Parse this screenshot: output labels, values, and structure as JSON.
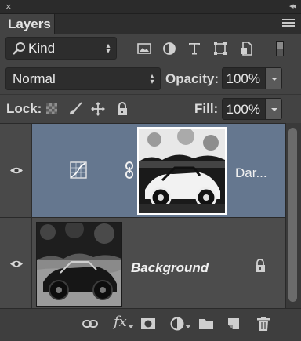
{
  "panel": {
    "close_glyph": "×",
    "collapse_glyph": "◂◂",
    "tab_label": "Layers",
    "menu_icon": "panel-menu-icon"
  },
  "filter": {
    "kind_label": "Kind",
    "icons": [
      "pixel-layer-filter-icon",
      "adjustment-layer-filter-icon",
      "type-layer-filter-icon",
      "shape-layer-filter-icon",
      "smart-object-filter-icon"
    ],
    "filter_toggle": "filter-toggle-icon"
  },
  "blend": {
    "mode": "Normal",
    "opacity_label": "Opacity:",
    "opacity_value": "100%"
  },
  "lock": {
    "label": "Lock:",
    "icons": [
      "lock-transparent-pixels-icon",
      "lock-image-pixels-icon",
      "lock-position-icon",
      "lock-all-icon"
    ],
    "fill_label": "Fill:",
    "fill_value": "100%"
  },
  "layers": [
    {
      "name": "Dar...",
      "type": "adjustment",
      "visible": true,
      "selected": true,
      "icon": "curves-adjustment-icon"
    },
    {
      "name": "Background",
      "type": "image",
      "visible": true,
      "selected": false,
      "locked": true
    }
  ],
  "bottom_bar": {
    "fx_label": "fx",
    "icons": [
      "link-layers-icon",
      "add-layer-style-icon",
      "add-mask-icon",
      "new-fill-adjustment-icon",
      "new-group-icon",
      "new-layer-icon",
      "delete-layer-icon"
    ]
  },
  "colors": {
    "panel_bg": "#434343",
    "selected_layer": "#65778f",
    "field_bg": "#2d2d2d"
  }
}
